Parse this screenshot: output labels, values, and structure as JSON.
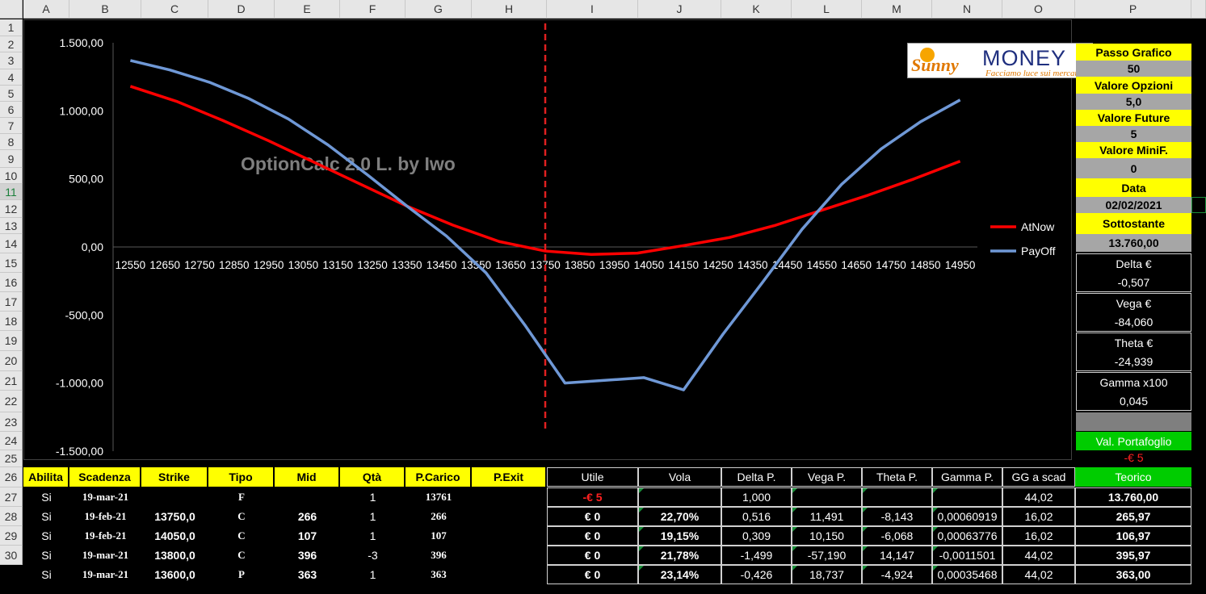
{
  "columns": [
    "A",
    "B",
    "C",
    "D",
    "E",
    "F",
    "G",
    "H",
    "I",
    "J",
    "K",
    "L",
    "M",
    "N",
    "O",
    "P"
  ],
  "rows": [
    "1",
    "2",
    "3",
    "4",
    "5",
    "6",
    "7",
    "8",
    "9",
    "10",
    "11",
    "12",
    "13",
    "14",
    "15",
    "16",
    "17",
    "18",
    "19",
    "20",
    "21",
    "22",
    "23",
    "24",
    "25",
    "26",
    "27",
    "28",
    "29",
    "30"
  ],
  "logo": {
    "brand1": "Sunny",
    "brand2": "MONEY",
    "tagline": "Facciamo luce sui mercati"
  },
  "watermark": "OptionCalc 2.0 L. by Iwo",
  "chart_data": {
    "type": "line",
    "x": [
      12550,
      12650,
      12750,
      12850,
      12950,
      13050,
      13150,
      13250,
      13350,
      13450,
      13550,
      13650,
      13750,
      13850,
      13950,
      14050,
      14150,
      14250,
      14350,
      14450,
      14550,
      14650,
      14750,
      14850,
      14950
    ],
    "x_tick_labels": [
      "12550",
      "12650",
      "12750",
      "12850",
      "12950",
      "13050",
      "13150",
      "13250",
      "13350",
      "13450",
      "13550",
      "13650",
      "13750",
      "13850",
      "13950",
      "14050",
      "14150",
      "14250",
      "14350",
      "14450",
      "14550",
      "14650",
      "14750",
      "14850",
      "14950"
    ],
    "y_tick_labels": [
      "1.500,00",
      "1.000,00",
      "500,00",
      "0,00",
      "-500,00",
      "-1.000,00",
      "-1.500,00"
    ],
    "y_ticks": [
      1500,
      1000,
      500,
      0,
      -500,
      -1000,
      -1500
    ],
    "ylim": [
      -1500,
      1500
    ],
    "xlim": [
      12500,
      15000
    ],
    "vline_x": 13750,
    "series": [
      {
        "name": "AtNow",
        "color": "#ff0000",
        "values": [
          1180,
          1070,
          930,
          780,
          620,
          460,
          300,
          160,
          40,
          -30,
          -55,
          -45,
          10,
          70,
          160,
          270,
          380,
          500,
          630
        ]
      },
      {
        "name": "PayOff",
        "color": "#6f98d6",
        "values": [
          1370,
          1300,
          1210,
          1090,
          940,
          750,
          530,
          300,
          80,
          -190,
          -580,
          -1000,
          -980,
          -960,
          -1050,
          -640,
          -260,
          130,
          460,
          720,
          920,
          1080
        ]
      }
    ],
    "series_x": [
      [
        12550,
        12650,
        12750,
        12850,
        12950,
        13050,
        13150,
        13250,
        13350,
        13450,
        13550,
        13650,
        13750,
        13850,
        13950,
        14050,
        14150,
        14250,
        14350,
        14450,
        14550,
        14650,
        14750,
        14850,
        14950
      ],
      [
        12550,
        12650,
        12750,
        12850,
        12950,
        13050,
        13150,
        13250,
        13350,
        13450,
        13550,
        13650,
        13750,
        13850,
        13950,
        14050,
        14150,
        14250,
        14350,
        14450,
        14550,
        14650,
        14750,
        14850,
        14950
      ]
    ],
    "legend": "right"
  },
  "panel": {
    "passo_label": "Passo Grafico",
    "passo": "50",
    "opzioni_label": "Valore Opzioni",
    "opzioni": "5,0",
    "future_label": "Valore Future",
    "future": "5",
    "minif_label": "Valore MiniF.",
    "minif": "0",
    "data_label": "Data",
    "data": "02/02/2021",
    "sott_label": "Sottostante",
    "sott": "13.760,00",
    "delta_label": "Delta €",
    "delta": "-0,507",
    "vega_label": "Vega €",
    "vega": "-84,060",
    "theta_label": "Theta €",
    "theta": "-24,939",
    "gamma_label": "Gamma x100",
    "gamma": "0,045",
    "port_label": "Val. Portafoglio",
    "port": "-€ 5"
  },
  "table": {
    "headers": [
      "Abilita",
      "Scadenza",
      "Strike",
      "Tipo",
      "Mid",
      "Qtà",
      "P.Carico",
      "P.Exit",
      "Utile",
      "Vola",
      "Delta P.",
      "Vega P.",
      "Theta P.",
      "Gamma P.",
      "GG a scad",
      "Teorico"
    ],
    "rows": [
      [
        "Si",
        "19-mar-21",
        "",
        "F",
        "",
        "1",
        "13761",
        "",
        "-€ 5",
        "",
        "1,000",
        "",
        "",
        "",
        "44,02",
        "13.760,00"
      ],
      [
        "Si",
        "19-feb-21",
        "13750,0",
        "C",
        "266",
        "1",
        "266",
        "",
        "€ 0",
        "22,70%",
        "0,516",
        "11,491",
        "-8,143",
        "0,00060919",
        "16,02",
        "265,97"
      ],
      [
        "Si",
        "19-feb-21",
        "14050,0",
        "C",
        "107",
        "1",
        "107",
        "",
        "€ 0",
        "19,15%",
        "0,309",
        "10,150",
        "-6,068",
        "0,00063776",
        "16,02",
        "106,97"
      ],
      [
        "Si",
        "19-mar-21",
        "13800,0",
        "C",
        "396",
        "-3",
        "396",
        "",
        "€ 0",
        "21,78%",
        "-1,499",
        "-57,190",
        "14,147",
        "-0,0011501",
        "44,02",
        "395,97"
      ],
      [
        "Si",
        "19-mar-21",
        "13600,0",
        "P",
        "363",
        "1",
        "363",
        "",
        "€ 0",
        "23,14%",
        "-0,426",
        "18,737",
        "-4,924",
        "0,00035468",
        "44,02",
        "363,00"
      ]
    ]
  }
}
